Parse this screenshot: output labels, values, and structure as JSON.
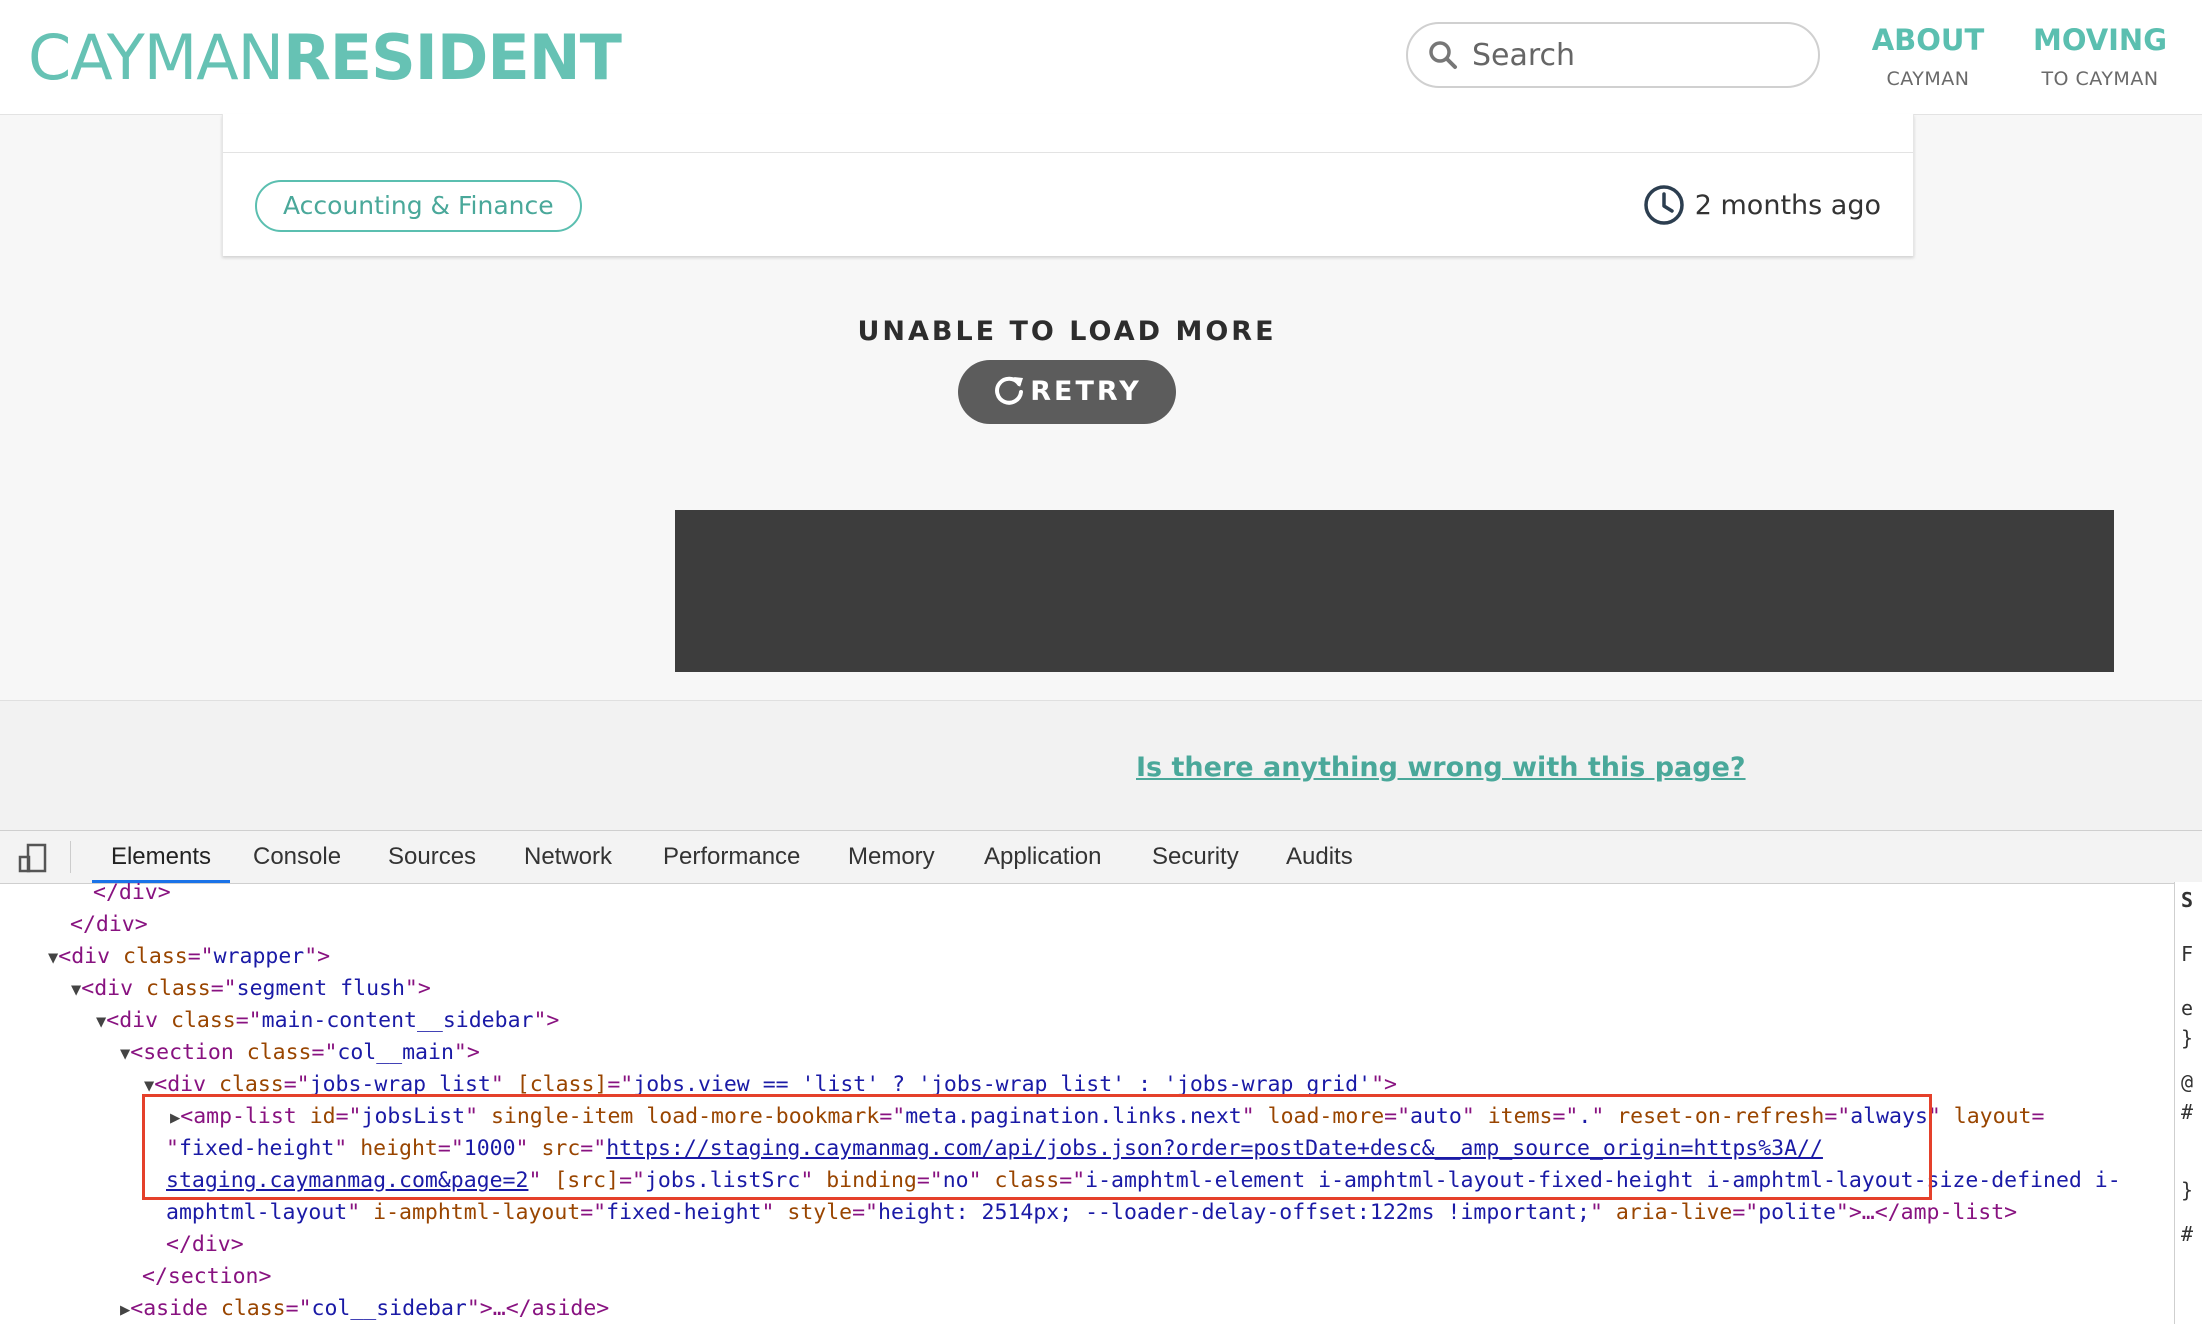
{
  "header": {
    "logo_light": "CAYMAN",
    "logo_bold": "RESIDENT",
    "search_placeholder": "Search",
    "nav": [
      {
        "title": "ABOUT",
        "subtitle": "CAYMAN"
      },
      {
        "title": "MOVING",
        "subtitle": "TO CAYMAN"
      }
    ]
  },
  "job_card": {
    "category": "Accounting & Finance",
    "posted": "2 months ago"
  },
  "load_more": {
    "message": "UNABLE TO LOAD MORE",
    "retry_label": "RETRY"
  },
  "footer": {
    "report_link": "Is there anything wrong with this page?"
  },
  "devtools": {
    "tabs": [
      "Elements",
      "Console",
      "Sources",
      "Network",
      "Performance",
      "Memory",
      "Application",
      "Security",
      "Audits"
    ],
    "active_tab": "Elements",
    "dom_lines": {
      "l1": "</div>",
      "l2": "</div>",
      "l3_tag": "div",
      "l3_attr": "class",
      "l3_val": "wrapper",
      "l4_tag": "div",
      "l4_attr": "class",
      "l4_val": "segment flush",
      "l5_tag": "div",
      "l5_attr": "class",
      "l5_val": "main-content__sidebar",
      "l6_tag": "section",
      "l6_attr": "class",
      "l6_val": "col__main",
      "l7_tag": "div",
      "l7_attr1": "class",
      "l7_val1": "jobs-wrap list",
      "l7_attr2": "[class]",
      "l7_val2": "jobs.view == 'list' ? 'jobs-wrap list' : 'jobs-wrap grid'",
      "amp_tag": "amp-list",
      "amp_id_val": "jobsList",
      "amp_single_item": "single-item",
      "amp_bookmark_val": "meta.pagination.links.next",
      "amp_load_more_val": "auto",
      "amp_items_val": ".",
      "amp_reset_val": "always",
      "amp_layout_val": "fixed-height",
      "amp_height_val": "1000",
      "amp_src_val_a": "https://staging.caymanmag.com/api/jobs.json?order=postDate+desc&__amp_source_origin=https%3A//",
      "amp_src_val_b": "staging.caymanmag.com&page=2",
      "amp_bsrc_val": "jobs.listSrc",
      "amp_binding_val": "no",
      "amp_class_val_a": "i-amphtml-element i-amphtml-layout-fixed-height i-amphtml-layout-size-defined i-",
      "amp_class_val_b": "amphtml-layout",
      "amp_ilayout_val": "fixed-height",
      "amp_style_val": "height: 2514px; --loader-delay-offset:122ms !important;",
      "amp_aria_val": "polite",
      "l9": "</div>",
      "l10": "</section>",
      "l11_tag": "aside",
      "l11_attr": "class",
      "l11_val": "col__sidebar"
    },
    "right_pane_chars": [
      "S",
      "F",
      "e",
      "}",
      "@",
      "#",
      "}",
      "#"
    ]
  }
}
